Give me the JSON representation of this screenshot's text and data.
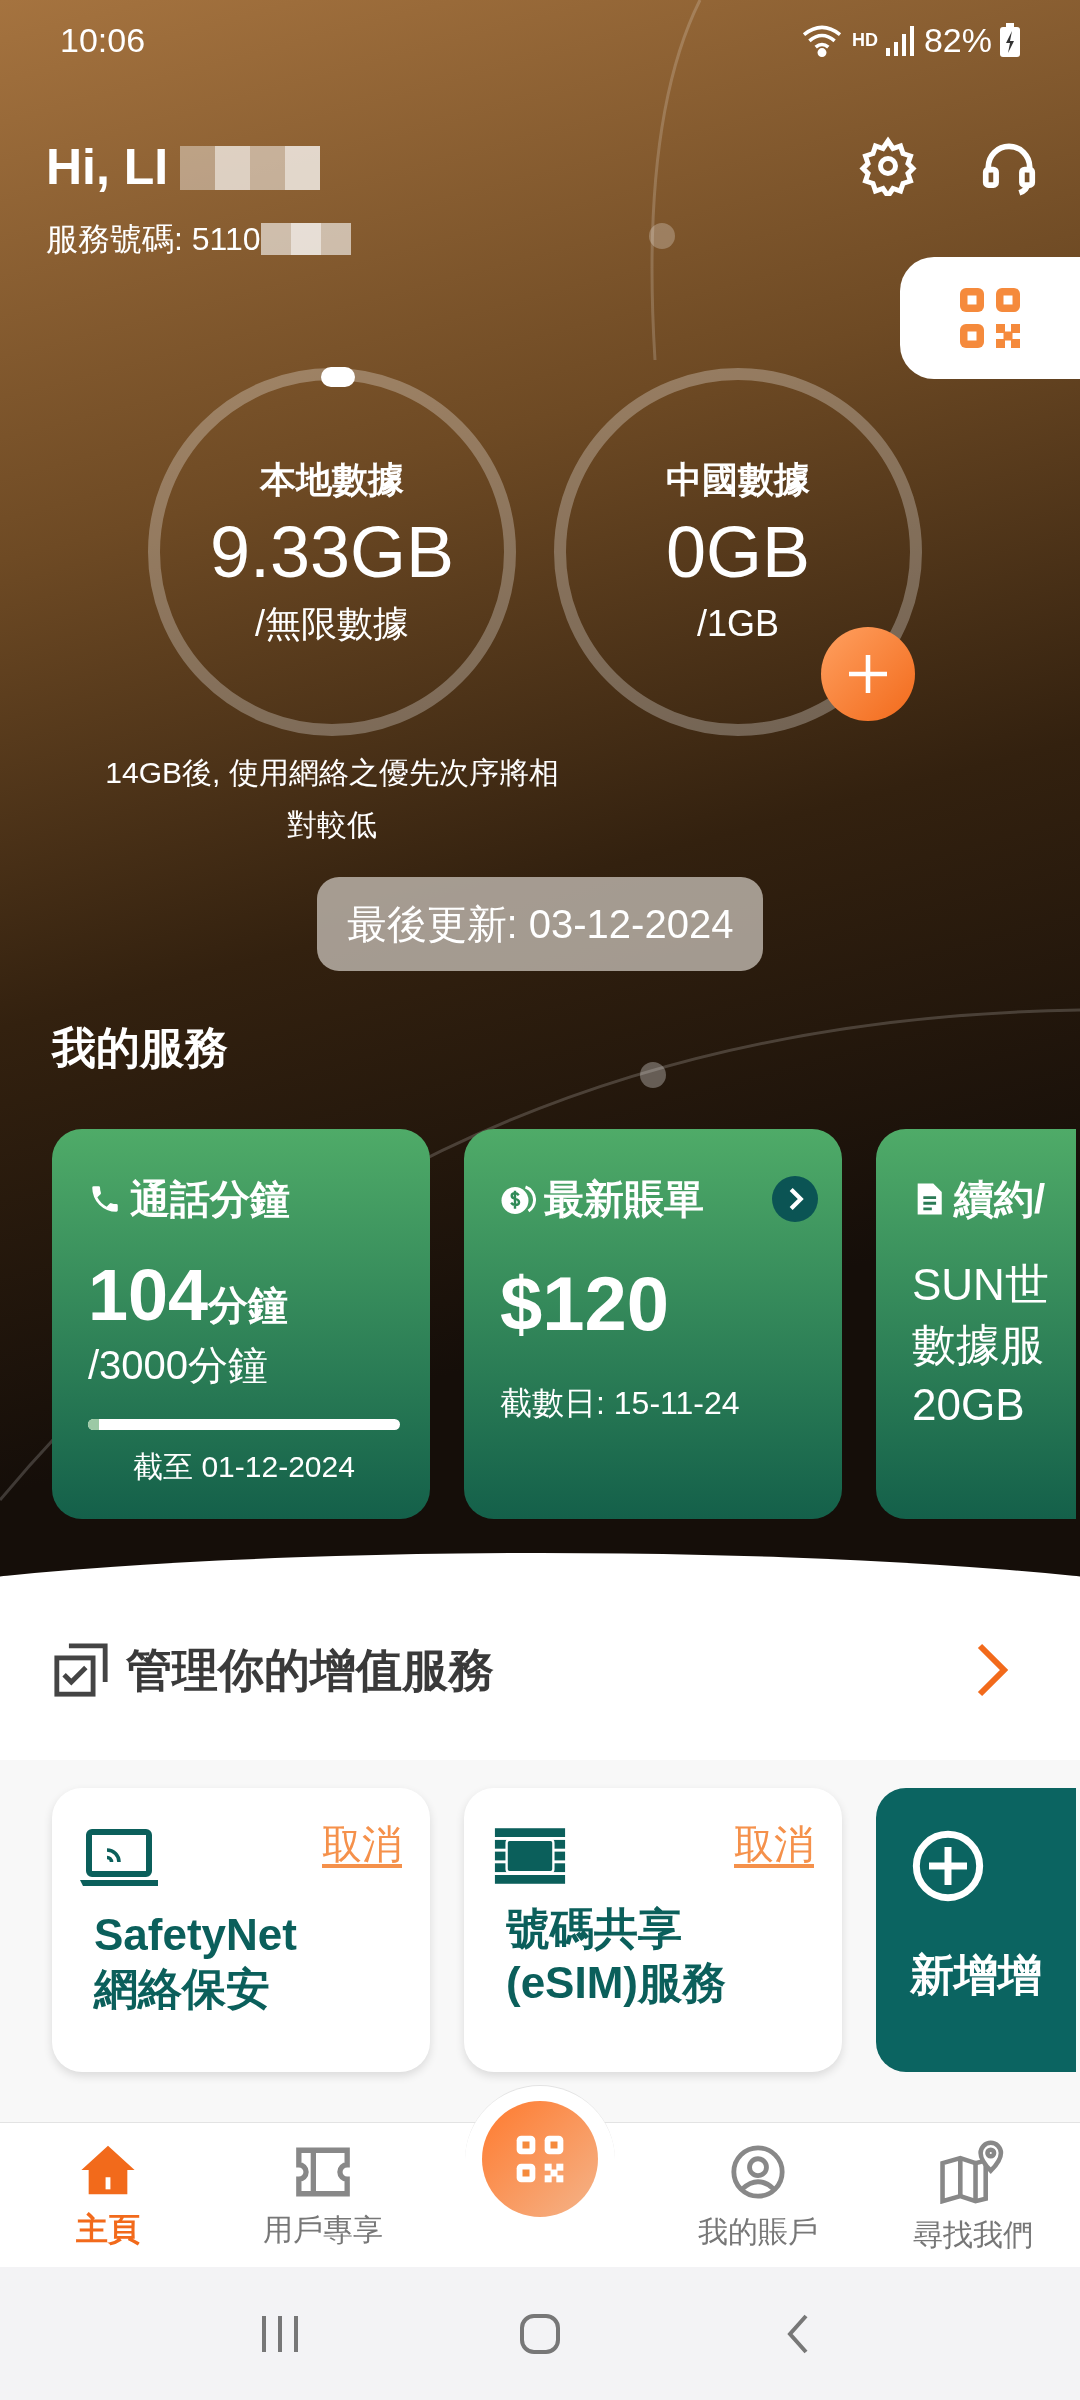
{
  "status_bar": {
    "time": "10:06",
    "network": "HD",
    "battery": "82%"
  },
  "header": {
    "greeting": "Hi, LI",
    "service_number": "服務號碼: 5110"
  },
  "data_usage": [
    {
      "title": "本地數據",
      "amount": "9.33GB",
      "quota": "/無限數據",
      "has_add": false
    },
    {
      "title": "中國數據",
      "amount": "0GB",
      "quota": "/1GB",
      "has_add": true
    }
  ],
  "fair_use_note": "14GB後, 使用網絡之優先次序將相對較低",
  "last_updated": "最後更新: 03-12-2024",
  "my_services": {
    "title": "我的服務",
    "cards": [
      {
        "kind": "minutes",
        "title": "通話分鐘",
        "value": "104",
        "unit": "分鐘",
        "quota": "/3000分鐘",
        "level": 0.035,
        "footer": "截至 01-12-2024"
      },
      {
        "kind": "bill",
        "title": "最新賬單",
        "value": "$120",
        "footer": "截數日: 15-11-24"
      },
      {
        "kind": "contract",
        "title": "續約/",
        "lines": [
          "SUN世",
          "數據服",
          "20GB"
        ]
      }
    ]
  },
  "value_added": {
    "title": "管理你的增值服務",
    "cards": [
      {
        "kind": "service",
        "action": "取消",
        "lines": [
          "SafetyNet",
          "網絡保安"
        ]
      },
      {
        "kind": "service",
        "action": "取消",
        "lines": [
          "號碼共享",
          "(eSIM)服務"
        ]
      },
      {
        "kind": "add",
        "label": "新增增"
      }
    ]
  },
  "bottom_nav": [
    {
      "label": "主頁",
      "selected": true
    },
    {
      "label": "用戶專享",
      "selected": false
    },
    {
      "label": "我的賬戶",
      "selected": false
    },
    {
      "label": "尋找我們",
      "selected": false
    }
  ]
}
